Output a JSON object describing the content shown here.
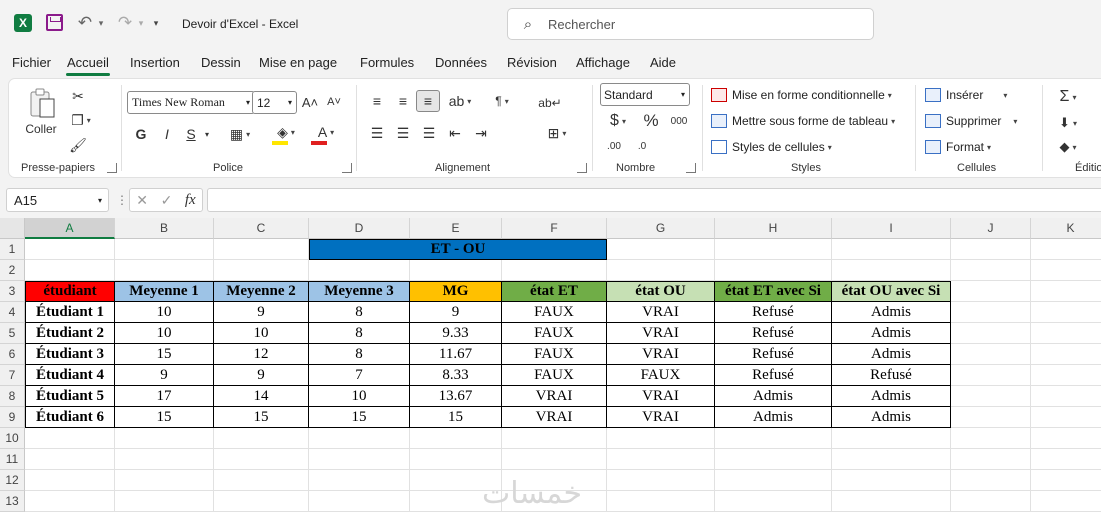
{
  "app": {
    "title": "Devoir d'Excel  -  Excel",
    "logo_letter": "X",
    "search_placeholder": "Rechercher"
  },
  "tabs": [
    "Fichier",
    "Accueil",
    "Insertion",
    "Dessin",
    "Mise en page",
    "Formules",
    "Données",
    "Révision",
    "Affichage",
    "Aide"
  ],
  "ribbon": {
    "clipboard": {
      "paste_label": "Coller",
      "group_label": "Presse-papiers"
    },
    "font": {
      "font_name": "Times New Roman",
      "font_size": "12",
      "bold": "G",
      "italic": "I",
      "underline": "S",
      "group_label": "Police",
      "fill_color": "#ffe600",
      "text_color": "#e02020"
    },
    "alignment": {
      "group_label": "Alignement"
    },
    "number": {
      "format": "Standard",
      "currency": "$",
      "percent": "%",
      "thousands": "000",
      "group_label": "Nombre"
    },
    "styles": {
      "conditional": "Mise en forme conditionnelle",
      "table": "Mettre sous forme de tableau",
      "cell_styles": "Styles de cellules",
      "group_label": "Styles"
    },
    "cells": {
      "insert": "Insérer",
      "delete": "Supprimer",
      "format": "Format",
      "group_label": "Cellules"
    },
    "editing": {
      "group_label": "Éditio"
    }
  },
  "formula_bar": {
    "name_box": "A15",
    "fx": "fx",
    "content": ""
  },
  "sheet": {
    "columns": [
      "A",
      "B",
      "C",
      "D",
      "E",
      "F",
      "G",
      "H",
      "I",
      "J",
      "K"
    ],
    "rows": [
      "1",
      "2",
      "3",
      "4",
      "5",
      "6",
      "7",
      "8",
      "9",
      "10",
      "11",
      "12",
      "13"
    ],
    "merged_title": "ET - OU",
    "headers": [
      "étudiant",
      "Meyenne 1",
      "Meyenne 2",
      "Meyenne 3",
      "MG",
      "état ET",
      "état OU",
      "état ET avec Si",
      "état OU avec Si"
    ],
    "header_colors": [
      "#ff0000",
      "#9dc3e6",
      "#9dc3e6",
      "#9dc3e6",
      "#ffc000",
      "#70ad47",
      "#c6e0b4",
      "#70ad47",
      "#c6e0b4"
    ],
    "title_color": "#0070c0",
    "data": [
      [
        "Étudiant 1",
        "10",
        "9",
        "8",
        "9",
        "FAUX",
        "VRAI",
        "Refusé",
        "Admis"
      ],
      [
        "Étudiant 2",
        "10",
        "10",
        "8",
        "9.33",
        "FAUX",
        "VRAI",
        "Refusé",
        "Admis"
      ],
      [
        "Étudiant 3",
        "15",
        "12",
        "8",
        "11.67",
        "FAUX",
        "VRAI",
        "Refusé",
        "Admis"
      ],
      [
        "Étudiant 4",
        "9",
        "9",
        "7",
        "8.33",
        "FAUX",
        "FAUX",
        "Refusé",
        "Refusé"
      ],
      [
        "Étudiant 5",
        "17",
        "14",
        "10",
        "13.67",
        "VRAI",
        "VRAI",
        "Admis",
        "Admis"
      ],
      [
        "Étudiant 6",
        "15",
        "15",
        "15",
        "15",
        "VRAI",
        "VRAI",
        "Admis",
        "Admis"
      ]
    ]
  },
  "watermark": "خمسات"
}
